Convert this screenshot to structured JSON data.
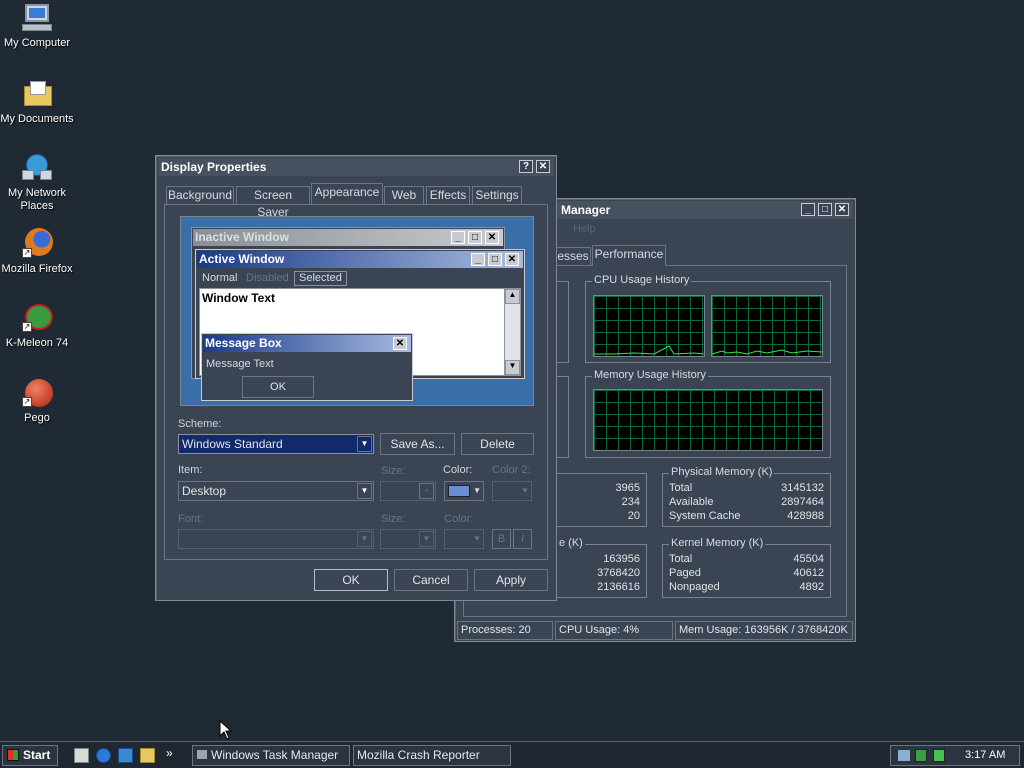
{
  "desktop": {
    "icons": [
      {
        "label": "My Computer",
        "icon": "computer-icon"
      },
      {
        "label": "My Documents",
        "icon": "folder-icon"
      },
      {
        "label": "My Network Places",
        "icon": "network-icon"
      },
      {
        "label": "Mozilla Firefox",
        "icon": "firefox-icon"
      },
      {
        "label": "K-Meleon 74",
        "icon": "kmeleon-icon"
      },
      {
        "label": "Pego",
        "icon": "pego-icon"
      }
    ]
  },
  "display_properties": {
    "title": "Display Properties",
    "tabs": [
      "Background",
      "Screen Saver",
      "Appearance",
      "Web",
      "Effects",
      "Settings"
    ],
    "selected_tab": "Appearance",
    "preview": {
      "inactive_title": "Inactive Window",
      "active_title": "Active Window",
      "menu_normal": "Normal",
      "menu_disabled": "Disabled",
      "menu_selected": "Selected",
      "window_text": "Window Text",
      "msgbox_title": "Message Box",
      "msgbox_text": "Message Text",
      "msgbox_ok": "OK"
    },
    "scheme_label": "Scheme:",
    "scheme_value": "Windows Standard",
    "save_as": "Save As...",
    "delete": "Delete",
    "item_label": "Item:",
    "item_value": "Desktop",
    "size_label": "Size:",
    "color_label": "Color:",
    "color2_label": "Color 2:",
    "font_label": "Font:",
    "size2_label": "Size:",
    "color3_label": "Color:",
    "bold": "B",
    "italic": "I",
    "ok": "OK",
    "cancel": "Cancel",
    "apply": "Apply",
    "swatch_color": "#6b8fd6"
  },
  "task_manager": {
    "title": "Manager",
    "menu_fragment": "Help",
    "tab_partial": "esses",
    "tab_performance": "Performance",
    "cpu_history": "CPU Usage History",
    "mem_history": "Memory Usage History",
    "totals_values": [
      "3965",
      "234",
      "20"
    ],
    "physical": {
      "title": "Physical Memory (K)",
      "rows": [
        {
          "k": "Total",
          "v": "3145132"
        },
        {
          "k": "Available",
          "v": "2897464"
        },
        {
          "k": "System Cache",
          "v": "428988"
        }
      ]
    },
    "commit_partial": "e (K)",
    "commit_values": [
      "163956",
      "3768420",
      "2136616"
    ],
    "kernel": {
      "title": "Kernel Memory (K)",
      "rows": [
        {
          "k": "Total",
          "v": "45504"
        },
        {
          "k": "Paged",
          "v": "40612"
        },
        {
          "k": "Nonpaged",
          "v": "4892"
        }
      ]
    },
    "status": {
      "processes": "Processes: 20",
      "cpu": "CPU Usage: 4%",
      "mem": "Mem Usage: 163956K / 3768420K"
    }
  },
  "taskbar": {
    "start": "Start",
    "tasks": [
      "Windows Task Manager",
      "Mozilla Crash Reporter"
    ],
    "overflow": "»",
    "clock": "3:17 AM"
  }
}
